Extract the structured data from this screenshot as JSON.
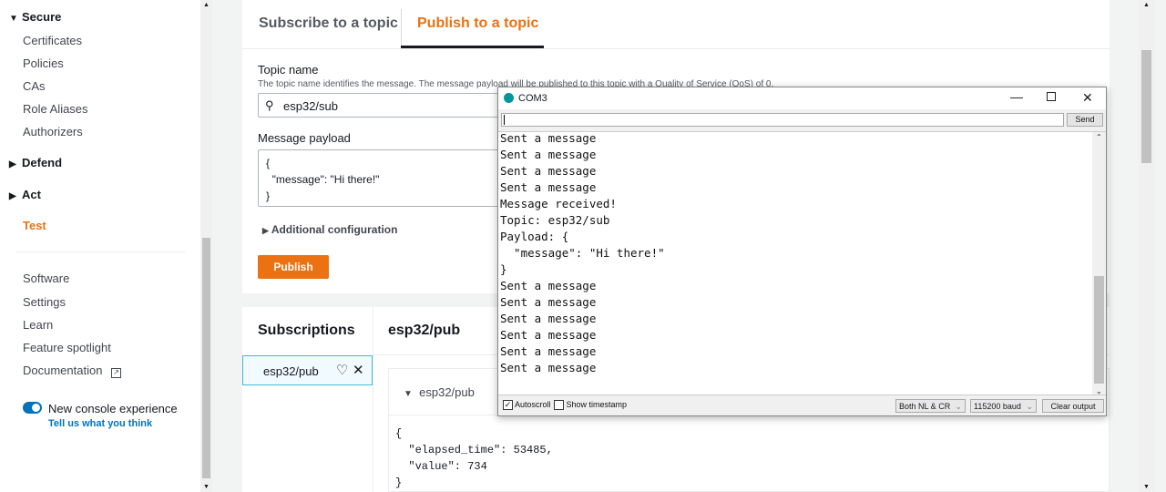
{
  "sidebar": {
    "secure": "Secure",
    "secure_items": [
      "Certificates",
      "Policies",
      "CAs",
      "Role Aliases",
      "Authorizers"
    ],
    "defend": "Defend",
    "act": "Act",
    "test": "Test",
    "bottom_items": [
      "Software",
      "Settings",
      "Learn",
      "Feature spotlight",
      "Documentation"
    ],
    "toggle_label": "New console experience",
    "feedback_link": "Tell us what you think",
    "toggle_on": true
  },
  "tabs": [
    "Subscribe to a topic",
    "Publish to a topic"
  ],
  "active_tab": "Publish to a topic",
  "form": {
    "topic_label": "Topic name",
    "topic_help": "The topic name identifies the message. The message payload will be published to this topic with a Quality of Service (QoS) of 0.",
    "topic_value": "esp32/sub",
    "payload_label": "Message payload",
    "payload_lines": [
      "{",
      "  \"message\": \"Hi there!\"",
      "}"
    ],
    "additional": "Additional configuration",
    "publish": "Publish"
  },
  "subscriptions": {
    "title": "Subscriptions",
    "items": [
      "esp32/pub"
    ],
    "topic_title": "esp32/pub",
    "message_topic": "esp32/pub",
    "message_lines": [
      "{",
      "  \"elapsed_time\": 53485,",
      "  \"value\": 734",
      "}"
    ]
  },
  "serial": {
    "title": "COM3",
    "send": "Send",
    "input_value": "",
    "lines": [
      "Sent a message",
      "Sent a message",
      "Sent a message",
      "Sent a message",
      "Message received!",
      "Topic: esp32/sub",
      "Payload: {",
      "  \"message\": \"Hi there!\"",
      "}",
      "Sent a message",
      "Sent a message",
      "Sent a message",
      "Sent a message",
      "Sent a message",
      "Sent a message"
    ],
    "autoscroll": "Autoscroll",
    "autoscroll_checked": true,
    "timestamp": "Show timestamp",
    "timestamp_checked": false,
    "line_ending": "Both NL & CR",
    "baud": "115200 baud",
    "clear": "Clear output"
  },
  "colors": {
    "accent": "#ec7211",
    "link": "#0073bb"
  }
}
